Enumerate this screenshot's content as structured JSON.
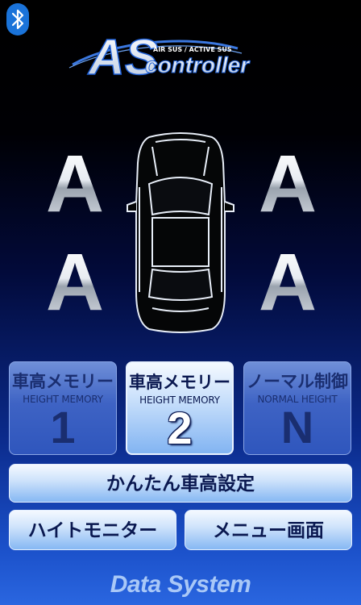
{
  "header": {
    "bluetooth_icon": "bluetooth-icon",
    "logo": {
      "mark": "AS",
      "tagline": "AIR SUS / ACTIVE SUS",
      "wordmark": "controller"
    }
  },
  "wheels": {
    "front_left": "A",
    "front_right": "A",
    "rear_left": "A",
    "rear_right": "A"
  },
  "car_icon": "car-top-view-icon",
  "memory_buttons": [
    {
      "label_jp": "車高メモリー",
      "label_en": "HEIGHT MEMORY",
      "value": "1",
      "selected": false
    },
    {
      "label_jp": "車高メモリー",
      "label_en": "HEIGHT MEMORY",
      "value": "2",
      "selected": true
    },
    {
      "label_jp": "ノーマル制御",
      "label_en": "NORMAL HEIGHT",
      "value": "N",
      "selected": false
    }
  ],
  "buttons": {
    "easy_height_setting": "かんたん車高設定",
    "height_monitor": "ハイトモニター",
    "menu_screen": "メニュー画面"
  },
  "footer": {
    "brand": "Data System"
  },
  "colors": {
    "bluetooth": "#1a73d9",
    "button_text": "#0a1850",
    "brand": "#a9c8f7"
  }
}
